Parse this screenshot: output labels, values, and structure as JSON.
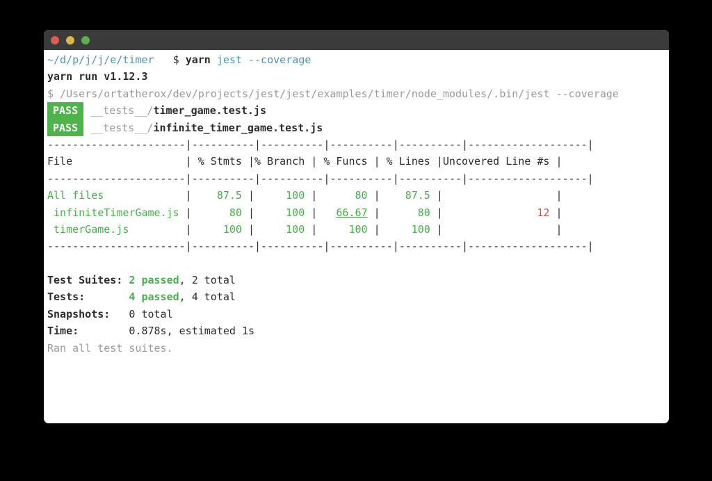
{
  "palette": {
    "background": "#000000",
    "window_bg": "#ffffff",
    "titlebar_bg": "#3b3b3b",
    "dot_red": "#dd5d55",
    "dot_yellow": "#ddb644",
    "dot_green": "#58b14b",
    "text": "#2d2d2d",
    "blue": "#4e93bb",
    "gray": "#9a9a9a",
    "green": "#47b04c",
    "red": "#c9504e",
    "badge_bg": "#4fb34b",
    "badge_text": "#ffffff"
  },
  "prompt": {
    "path": "~/d/p/j/j/e/timer",
    "separator": "   $ ",
    "command_bold": "yarn ",
    "command_rest": "jest --coverage"
  },
  "yarn_version_line": "yarn run v1.12.3",
  "command_echo_line": "$ /Users/ortatherox/dev/projects/jest/jest/examples/timer/node_modules/.bin/jest --coverage",
  "test_results": [
    {
      "badge": "PASS",
      "dir": "__tests__/",
      "file": "timer_game.test.js"
    },
    {
      "badge": "PASS",
      "dir": "__tests__/",
      "file": "infinite_timer_game.test.js"
    }
  ],
  "coverage": {
    "sep": "|",
    "divider": "----------------------|----------|----------|----------|----------|-------------------|",
    "header": {
      "file": "File",
      "stmts": "% Stmts",
      "branch": "% Branch",
      "funcs": "% Funcs",
      "lines": "% Lines",
      "uncovered": "Uncovered Line #s"
    },
    "rows": [
      {
        "file": "All files",
        "stmts": "87.5",
        "branch": "100",
        "funcs": "80",
        "lines": "87.5",
        "uncovered": ""
      },
      {
        "file": " infiniteTimerGame.js",
        "stmts": "80",
        "branch": "100",
        "funcs": "66.67",
        "lines": "80",
        "uncovered": "12"
      },
      {
        "file": " timerGame.js",
        "stmts": "100",
        "branch": "100",
        "funcs": "100",
        "lines": "100",
        "uncovered": ""
      }
    ]
  },
  "summary": {
    "rows": [
      {
        "label": "Test Suites:",
        "passed": "2 passed",
        "rest": ", 2 total"
      },
      {
        "label": "Tests:",
        "passed": "4 passed",
        "rest": ", 4 total"
      },
      {
        "label": "Snapshots:",
        "passed": "",
        "rest": "0 total"
      },
      {
        "label": "Time:",
        "passed": "",
        "rest": "0.878s, estimated 1s"
      }
    ],
    "footer": "Ran all test suites."
  }
}
